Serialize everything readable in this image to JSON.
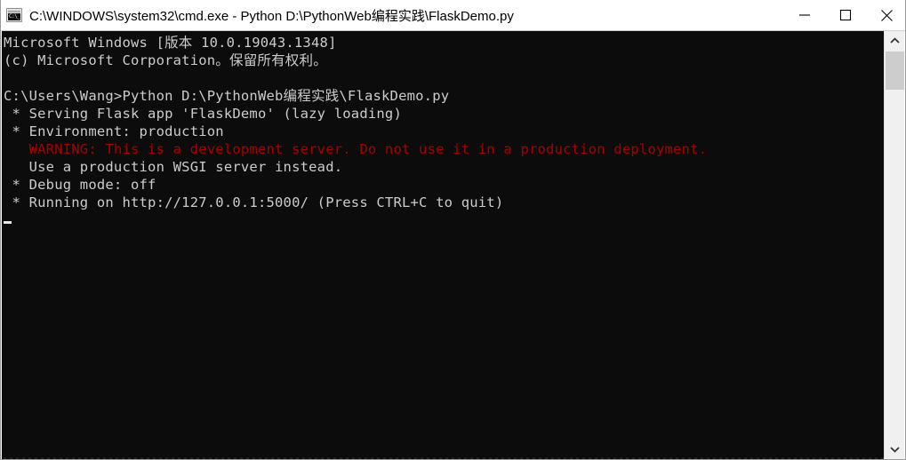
{
  "window": {
    "title": "C:\\WINDOWS\\system32\\cmd.exe - Python  D:\\PythonWeb编程实践\\FlaskDemo.py",
    "icon": "cmd-console-icon",
    "icon_glyph": "C:\\_",
    "background_color": "#0c0c0c",
    "text_color": "#cccccc",
    "warning_color": "#a80000",
    "controls": {
      "minimize": "minimize-icon",
      "maximize": "maximize-icon",
      "close": "close-icon"
    }
  },
  "console": {
    "lines": [
      {
        "text": "Microsoft Windows [版本 10.0.19043.1348]",
        "color": "normal"
      },
      {
        "text": "(c) Microsoft Corporation。保留所有权利。",
        "color": "normal"
      },
      {
        "text": "",
        "color": "normal"
      },
      {
        "text": "C:\\Users\\Wang>Python D:\\PythonWeb编程实践\\FlaskDemo.py",
        "color": "normal"
      },
      {
        "text": " * Serving Flask app 'FlaskDemo' (lazy loading)",
        "color": "normal"
      },
      {
        "text": " * Environment: production",
        "color": "normal"
      },
      {
        "text": "   WARNING: This is a development server. Do not use it in a production deployment.",
        "color": "red"
      },
      {
        "text": "   Use a production WSGI server instead.",
        "color": "normal"
      },
      {
        "text": " * Debug mode: off",
        "color": "normal"
      },
      {
        "text": " * Running on http://127.0.0.1:5000/ (Press CTRL+C to quit)",
        "color": "normal"
      }
    ],
    "cursor_visible": true
  },
  "scrollbar": {
    "up_arrow": "chevron-up-icon",
    "down_arrow": "chevron-down-icon",
    "thumb_position": "near-top"
  }
}
